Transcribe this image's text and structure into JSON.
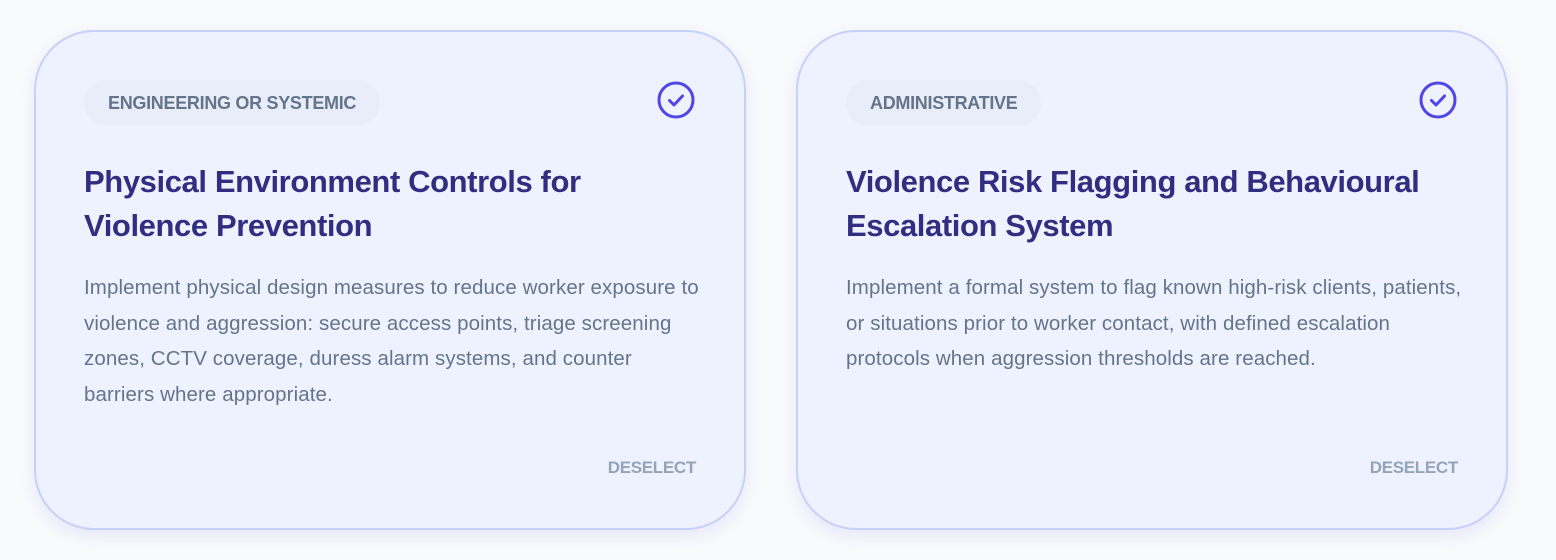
{
  "cards": [
    {
      "badge": "ENGINEERING OR SYSTEMIC",
      "title": "Physical Environment Controls for Violence Prevention",
      "description": "Implement physical design measures to reduce worker exposure to violence and aggression: secure access points, triage screening zones, CCTV coverage, duress alarm systems, and counter barriers where appropriate.",
      "action": "DESELECT",
      "selected": true,
      "icon": "check-circle-icon"
    },
    {
      "badge": "ADMINISTRATIVE",
      "title": "Violence Risk Flagging and Behavioural Escalation System",
      "description": "Implement a formal system to flag known high-risk clients, patients, or situations prior to worker contact, with defined escalation protocols when aggression thresholds are reached.",
      "action": "DESELECT",
      "selected": true,
      "icon": "check-circle-icon"
    }
  ],
  "colors": {
    "accent": "#4f46e5",
    "title": "#312e81",
    "card_bg": "#eef2fe",
    "card_border": "#c7d0f7",
    "muted": "#64748b",
    "action": "#94a3b8"
  }
}
